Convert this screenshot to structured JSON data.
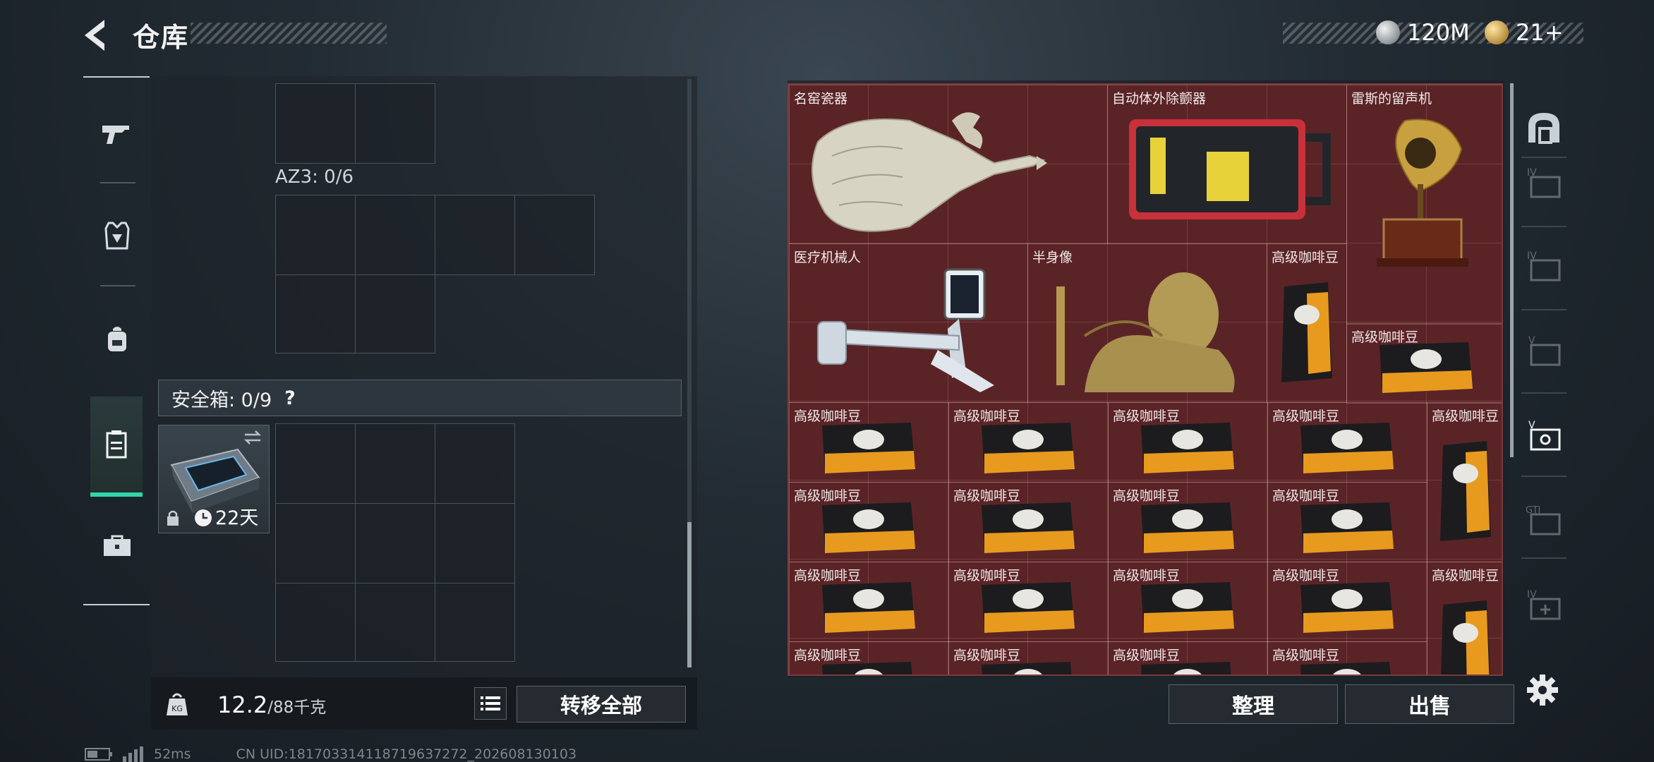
{
  "header": {
    "title": "仓库",
    "currencies": [
      {
        "name": "silver-coin",
        "value": "120M"
      },
      {
        "name": "gold-coin",
        "value": "21+"
      }
    ]
  },
  "left_nav": [
    "weapon-icon",
    "armor-icon",
    "backpack-icon",
    "safe-box-icon",
    "toolbox-icon"
  ],
  "containers": {
    "az3_label": "AZ3: 0/6",
    "safe_box_label": "安全箱: 0/9",
    "safe_box_help": "?",
    "case_item": {
      "duration": "22天"
    }
  },
  "bottom_left": {
    "weight_value": "12.2",
    "weight_cap": "/88千克",
    "transfer_all": "转移全部"
  },
  "stash_items": {
    "vase": "名窑瓷器",
    "aed": "自动体外除颤器",
    "gramophone": "雷斯的留声机",
    "med_robot": "医疗机械人",
    "bust": "半身像",
    "coffee": "高级咖啡豆"
  },
  "right_nav": [
    "locker-icon",
    "storage-tab-1-icon",
    "storage-tab-2-icon",
    "storage-tab-3-icon",
    "storage-tab-4-icon",
    "storage-tab-5-icon",
    "storage-tab-6-icon"
  ],
  "bottom_right": {
    "sort": "整理",
    "sell": "出售"
  },
  "footer": {
    "ping": "52ms",
    "uid": "CN UID:181703314118719637272_202608130103"
  },
  "colors": {
    "accent": "#31d6a8",
    "stash_bg": "#5a2427"
  }
}
